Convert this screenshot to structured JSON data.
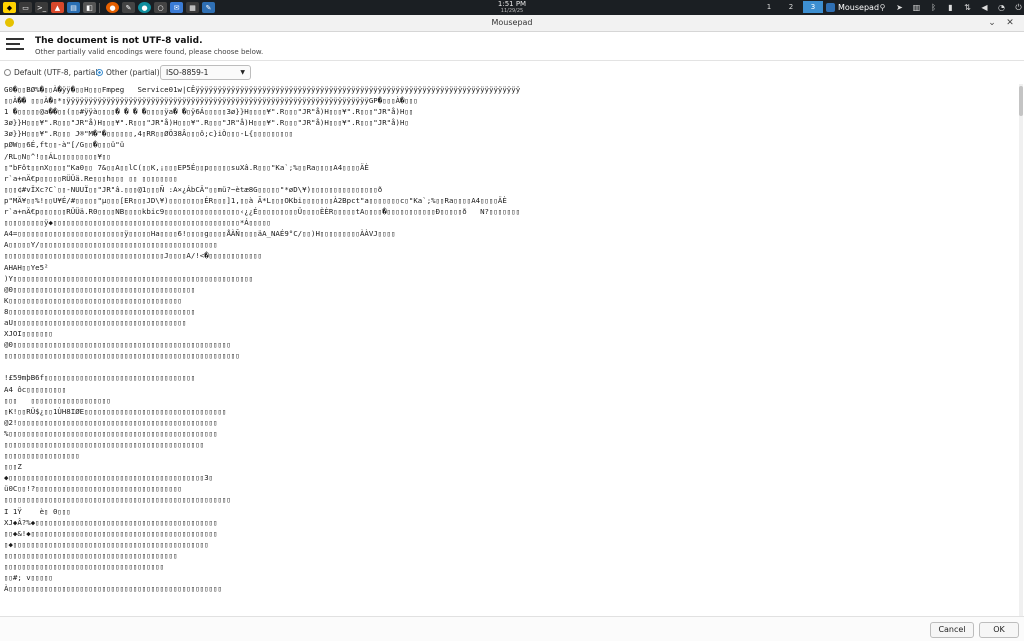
{
  "taskbar": {
    "time": "1:51 PM",
    "date": "11/29/25",
    "workspaces": [
      "1",
      "2",
      "3"
    ],
    "active_workspace": "3",
    "task_title": "Mousepad",
    "accent": "#3d8fd1"
  },
  "window": {
    "title": "Mousepad",
    "minimize_icon": "chevron-down-icon",
    "close_icon": "close-icon"
  },
  "infobar": {
    "title": "The document is not UTF-8 valid.",
    "subtitle": "Other partially valid encodings were found, please choose below."
  },
  "encoding": {
    "option_default": "Default (UTF-8, partial)",
    "option_other": "Other (partial):",
    "selected": "ISO-8859-1"
  },
  "editor": {
    "lines": [
      "G0�▯▯BØ%�▯▯À�ÿÿ�▯▯H▯▯▯Fmpeg   Service01w|CÊÿÿÿÿÿÿÿÿÿÿÿÿÿÿÿÿÿÿÿÿÿÿÿÿÿÿÿÿÿÿÿÿÿÿÿÿÿÿÿÿÿÿÿÿÿÿÿÿÿÿÿÿÿÿÿÿÿÿÿÿÿÿÿÿÿÿÿÿÿÿÿÿÿ",
      "▯▯À�� ▯▯▯À�▯*▯ÿÿÿÿÿÿÿÿÿÿÿÿÿÿÿÿÿÿÿÿÿÿÿÿÿÿÿÿÿÿÿÿÿÿÿÿÿÿÿÿÿÿÿÿÿÿÿÿÿÿÿÿÿÿÿÿÿÿÿÿÿÿÿÿÿÿÿÿGP�▯▯▯À�▯▯▯",
      "1 �▯▯▯▯▯@a��▯▯(▯▯#ÿÿà▯▯▯▯� � � �▯▯▯▯ÿa� �▯ÿ6Á▯▯▯▯▯3ø}}H▯▯▯▯¥\".R▯▯▯\"JR\"å)H▯▯▯¥\".R▯▯▯\"JR\"å)H▯▯",
      "3ø}}H▯▯▯¥\".R▯▯▯\"JR\"å)H▯▯▯¥\".R▯▯▯\"JR\"å)H▯▯▯¥\".R▯▯▯\"JR\"å)H▯▯▯¥\".R▯▯▯\"JR\"å)H▯▯▯¥\".R▯▯▯\"JR\"å)H▯",
      "3ø}}H▯▯▯¥\".R▯▯▯ J®\"M�\"�▯▯▯▯▯▯,4▯RR▯▯ØÖ38Â▯▯▯ô;c}iÒ▯▯▯-L{▯▯▯▯▯▯▯▯▯",
      "pØW▯▯6É,ft▯▯-à\"[/G▯▯�▯▯▯ü\"ü",
      "/RL▯N▯^!▯▯ÁL▯▯▯▯▯▯▯▯▯¥▯▯",
      "▯\"bFôt▯▯nX▯▯▯▯\"Ka0▯▯ 7&▯▯A▯▯lC(▯▯K,¡▯▯▯EP5É▯▯p▯▯▯▯▯suXâ.R▯▯▯\"Ka`;%▯▯Ra▯▯▯▯A4▯▯▯▯ÄÈ",
      "r`a+nÄ€p▯▯▯▯▯RÜÜä.Re▯▯▯h▯▯▯ ▯▯ ▯▯▯▯▯▯▯▯",
      "▯▯▯¢#vÏXc?C`▯▯-NUUÏ▯▯\"JR\"â.▯▯▯@1▯▯▯Ñ :A×¿ÁbCÄ\"▯▯mü?~ètæ8G▯▯▯▯▯\"*øD\\¥)▯▯▯▯▯▯▯▯▯▯▯▯▯▯▯ð",
      "p\"MÄ¥▯▯%!▯▯U¥É/#▯▯▯▯▯\"µ▯▯▯[ER▯▯▯JD\\¥)▯▯▯▯▯▯▯▯ÉR▯▯▯]1,▯▯à Ã*L▯▯▯OKbi▯▯▯▯▯▯▯À2Bpct\"a▯▯▯▯▯▯▯c▯\"Ka`;%▯▯Ra▯▯▯▯A4▯▯▯▯ÄÈ",
      "r`a+nÄ€p▯▯▯▯▯▯RÜÜä.R0▯▯▯▯NB▯▯▯▯kbic9▯▯▯▯▯▯▯▯▯▯▯▯▯▯▯▯▯‹¿¿É▯▯▯▯▯▯▯▯▯Ü▯▯▯▯ÈÈR▯▯▯▯▯tA▯▯▯▯�▯▯▯▯▯▯▯▯▯▯▯Ð▯▯▯▯▯ð   N?▯▯▯▯▯▯▯",
      "▯▯▯▯▯▯▯▯▯ÿ◆▯▯▯▯▯▯▯▯▯▯▯▯▯▯▯▯▯▯▯▯▯▯▯▯▯▯▯▯▯▯▯▯▯▯▯▯▯▯▯▯▯▯*Á▯▯▯▯▯",
      "A4=▯▯▯▯▯▯▯▯▯▯▯▯▯▯▯▯▯▯▯▯▯▯▯▯ÿ▯▯▯▯▯Ha▯▯▯▯6!▯▯▯▯g▯▯▯▯ÅÀÑ▯▯▯▯äA_NAÉ9°C/▯▯)H▯▯▯▯▯▯▯▯▯ÀÀVJ▯▯▯▯",
      "A▯▯▯▯▯Y/▯▯▯▯▯▯▯▯▯▯▯▯▯▯▯▯▯▯▯▯▯▯▯▯▯▯▯▯▯▯▯▯▯▯▯▯▯▯▯▯",
      "▯▯▯▯▯▯▯▯▯▯▯▯▯▯▯▯▯▯▯▯▯▯▯▯▯▯▯▯▯▯▯▯▯▯▯▯J▯▯▯▯A/!<�▯▯▯▯▯▯▯▯▯▯▯▯",
      "AHAH▯▯Ye5²",
      ")Y▯▯▯▯▯▯▯▯▯▯▯▯▯▯▯▯▯▯▯▯▯▯▯▯▯▯▯▯▯▯▯▯▯▯▯▯▯▯▯▯▯▯▯▯▯▯▯▯▯▯▯▯▯▯",
      "@0▯▯▯▯▯▯▯▯▯▯▯▯▯▯▯▯▯▯▯▯▯▯▯▯▯▯▯▯▯▯▯▯▯▯▯▯▯▯▯▯▯",
      "K▯▯▯▯▯▯▯▯▯▯▯▯▯▯▯▯▯▯▯▯▯▯▯▯▯▯▯▯▯▯▯▯▯▯▯▯▯▯▯",
      "8▯▯▯▯▯▯▯▯▯▯▯▯▯▯▯▯▯▯▯▯▯▯▯▯▯▯▯▯▯▯▯▯▯▯▯▯▯▯▯▯▯▯",
      "aU▯▯▯▯▯▯▯▯▯▯▯▯▯▯▯▯▯▯▯▯▯▯▯▯▯▯▯▯▯▯▯▯▯▯▯▯▯▯▯",
      "XJOI▯▯▯▯▯▯▯",
      "@0▯▯▯▯▯▯▯▯▯▯▯▯▯▯▯▯▯▯▯▯▯▯▯▯▯▯▯▯▯▯▯▯▯▯▯▯▯▯▯▯▯▯▯▯▯▯▯▯▯",
      "▯▯▯▯▯▯▯▯▯▯▯▯▯▯▯▯▯▯▯▯▯▯▯▯▯▯▯▯▯▯▯▯▯▯▯▯▯▯▯▯▯▯▯▯▯▯▯▯▯▯▯▯▯",
      "",
      "!£59mþB6f▯▯▯▯▯▯▯▯▯▯▯▯▯▯▯▯▯▯▯▯▯▯▯▯▯▯▯▯▯▯▯▯▯▯",
      "A4 ôc▯▯▯▯▯▯▯▯▯",
      "▯▯▯   ▯▯▯▯▯▯▯▯▯▯▯▯▯▯▯▯▯▯",
      "▯K!▯▯RÜ$¿▯▯1ÙH8IØE▯▯▯▯▯▯▯▯▯▯▯▯▯▯▯▯▯▯▯▯▯▯▯▯▯▯▯▯▯▯▯▯",
      "@2!▯▯▯▯▯▯▯▯▯▯▯▯▯▯▯▯▯▯▯▯▯▯▯▯▯▯▯▯▯▯▯▯▯▯▯▯▯▯▯▯▯▯▯▯▯",
      "%▯▯▯▯▯▯▯▯▯▯▯▯▯▯▯▯▯▯▯▯▯▯▯▯▯▯▯▯▯▯▯▯▯▯▯▯▯▯▯▯▯▯▯▯▯▯▯",
      "▯▯▯▯▯▯▯▯▯▯▯▯▯▯▯▯▯▯▯▯▯▯▯▯▯▯▯▯▯▯▯▯▯▯▯▯▯▯▯▯▯▯▯▯▯",
      "▯▯▯▯▯▯▯▯▯▯▯▯▯▯▯▯▯",
      "▯▯▯Z",
      "◆▯▯▯▯▯▯▯▯▯▯▯▯▯▯▯▯▯▯▯▯▯▯▯▯▯▯▯▯▯▯▯▯▯▯▯▯▯▯▯▯▯▯▯▯3▯",
      "ü0C▯▯!?▯▯▯▯▯▯▯▯▯▯▯▯▯▯▯▯▯▯▯▯▯▯▯▯▯▯▯▯▯▯▯▯▯",
      "▯▯▯▯▯▯▯▯▯▯▯▯▯▯▯▯▯▯▯▯▯▯▯▯▯▯▯▯▯▯▯▯▯▯▯▯▯▯▯▯▯▯▯▯▯▯▯▯▯▯▯",
      "I 1Ÿ    è▯ 0▯▯▯",
      "XJ◆Â?%◆▯▯▯▯▯▯▯▯▯▯▯▯▯▯▯▯▯▯▯▯▯▯▯▯▯▯▯▯▯▯▯▯▯▯▯▯▯▯▯▯▯",
      "▯▯◆&!◆▯▯▯▯▯▯▯▯▯▯▯▯▯▯▯▯▯▯▯▯▯▯▯▯▯▯▯▯▯▯▯▯▯▯▯▯▯▯▯▯▯▯",
      "▯◆▯▯▯▯▯▯▯▯▯▯▯▯▯▯▯▯▯▯▯▯▯▯▯▯▯▯▯▯▯▯▯▯▯▯▯▯▯▯▯▯▯▯▯▯",
      "▯▯▯▯▯▯▯▯▯▯▯▯▯▯▯▯▯▯▯▯▯▯▯▯▯▯▯▯▯▯▯▯▯▯▯▯▯▯▯",
      "▯▯▯▯▯▯▯▯▯▯▯▯▯▯▯▯▯▯▯▯▯▯▯▯▯▯▯▯▯▯▯▯▯▯▯▯",
      "▯▯#; v▯▯▯▯▯",
      "À▯▯▯▯▯▯▯▯▯▯▯▯▯▯▯▯▯▯▯▯▯▯▯▯▯▯▯▯▯▯▯▯▯▯▯▯▯▯▯▯▯▯▯▯▯▯▯▯"
    ]
  },
  "buttons": {
    "cancel": "Cancel",
    "ok": "OK"
  }
}
